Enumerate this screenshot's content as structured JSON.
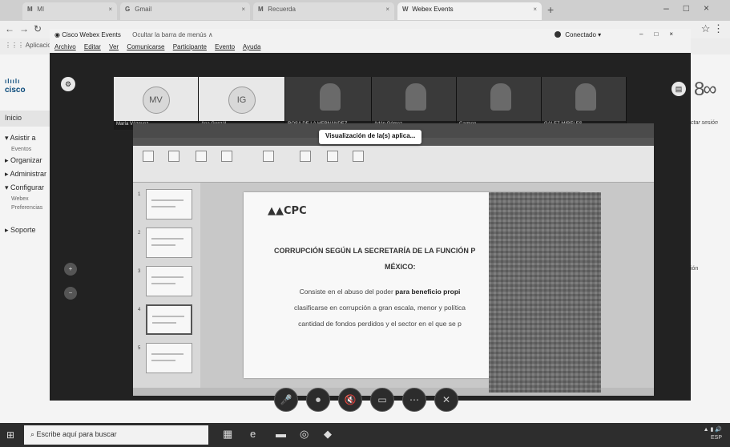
{
  "browser": {
    "tabs": [
      {
        "icon": "M",
        "label": "MI",
        "active": false
      },
      {
        "icon": "G",
        "label": "Gmail",
        "active": false
      },
      {
        "icon": "M",
        "label": "Recuerda",
        "active": false
      },
      {
        "icon": "W",
        "label": "Webex Events",
        "active": true
      }
    ],
    "new_tab": "+",
    "bookmarks_label": "Aplicaciones"
  },
  "cisco_page": {
    "logo": "cisco",
    "nav_home": "Inicio",
    "nav": [
      {
        "label": "▾ Asistir a",
        "children": [
          "Eventos"
        ]
      },
      {
        "label": "▸ Organizar",
        "children": []
      },
      {
        "label": "▸ Administrar",
        "children": []
      },
      {
        "label": "▾ Configurar",
        "children": [
          "Webex",
          "Preferencias"
        ]
      },
      {
        "label": "▸ Soporte",
        "children": []
      }
    ],
    "right_text": "ctar sesión",
    "right_text2": "ión"
  },
  "webex": {
    "window_title": "Cisco Webex Events",
    "hide_menu": "Ocultar la barra de menús ∧",
    "status": "Conectado ▾",
    "menu": [
      "Archivo",
      "Editar",
      "Ver",
      "Comunicarse",
      "Participante",
      "Evento",
      "Ayuda"
    ],
    "participants": [
      {
        "initials": "MV",
        "caption": "María Vázquez",
        "video": false
      },
      {
        "initials": "IG",
        "caption": "Ana Gonzál...",
        "video": false
      },
      {
        "initials": "",
        "caption": "ROSA DE LA HERNÁNDEZ",
        "video": true
      },
      {
        "initials": "",
        "caption": "Adán Gómez",
        "video": true
      },
      {
        "initials": "",
        "caption": "Carmen",
        "video": true
      },
      {
        "initials": "",
        "caption": "GALEZ MIRELES",
        "video": true
      }
    ],
    "tooltip": "Visualización de la(s) aplica...",
    "slide": {
      "logo": "CPC",
      "title_line1": "CORRUPCIÓN SEGÚN LA SECRETARÍA DE LA FUNCIÓN P",
      "title_line2": "MÉXICO:",
      "body_line1_pre": "Consiste en el abuso del poder ",
      "body_line1_bold": "para beneficio propi",
      "body_line2": "clasificarse en corrupción a gran escala, menor y política",
      "body_line3": "cantidad de fondos perdidos y el sector en el que se p"
    },
    "controls": [
      "🎤",
      "⏺",
      "🔇",
      "▭",
      "⋯",
      "✕"
    ]
  },
  "taskbar": {
    "search_placeholder": "Escribe aquí para buscar",
    "start_icon": "⊞"
  }
}
